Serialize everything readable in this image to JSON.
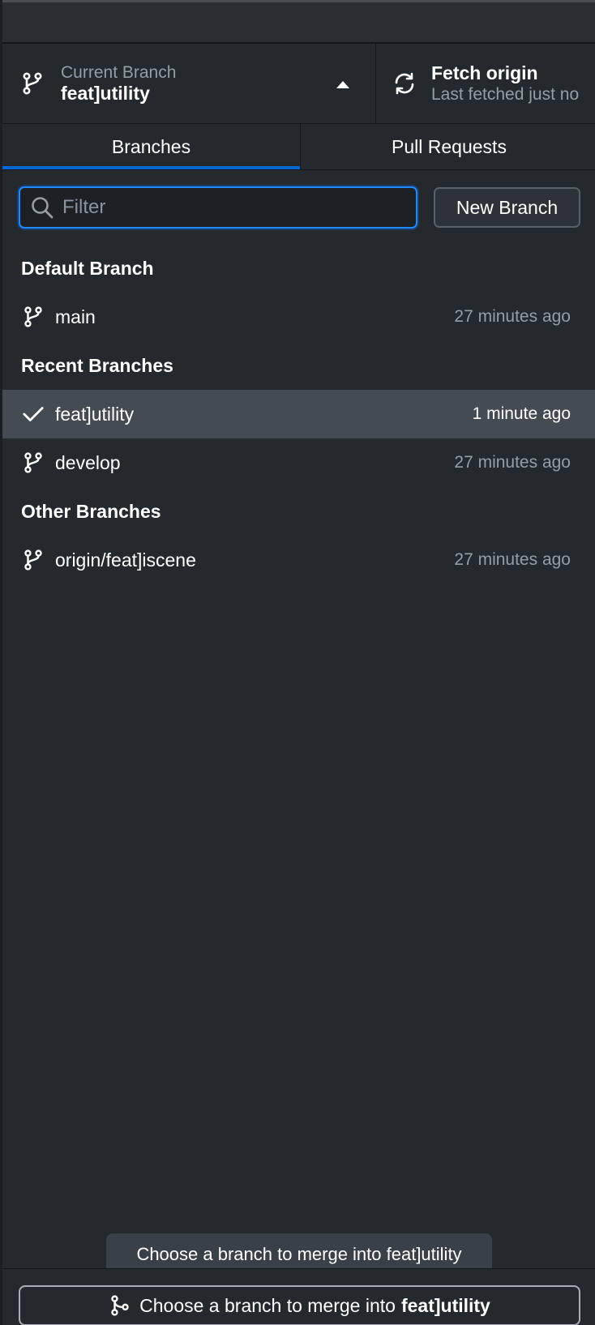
{
  "toolbar": {
    "current_branch_label": "Current Branch",
    "current_branch_value": "feat]utility",
    "fetch_title": "Fetch origin",
    "fetch_subtitle": "Last fetched just no"
  },
  "tabs": [
    {
      "label": "Branches",
      "active": true
    },
    {
      "label": "Pull Requests",
      "active": false
    }
  ],
  "filter": {
    "placeholder": "Filter",
    "value": ""
  },
  "new_branch_label": "New Branch",
  "sections": {
    "default": {
      "title": "Default Branch",
      "items": [
        {
          "name": "main",
          "time": "27 minutes ago",
          "icon": "git-branch-icon"
        }
      ]
    },
    "recent": {
      "title": "Recent Branches",
      "items": [
        {
          "name": "feat]utility",
          "time": "1 minute ago",
          "icon": "check-icon",
          "selected": true
        },
        {
          "name": "develop",
          "time": "27 minutes ago",
          "icon": "git-branch-icon"
        }
      ]
    },
    "other": {
      "title": "Other Branches",
      "items": [
        {
          "name": "origin/feat]iscene",
          "time": "27 minutes ago",
          "icon": "git-branch-icon"
        }
      ]
    }
  },
  "tooltip_text": "Choose a branch to merge into feat]utility",
  "merge_button": {
    "prefix": "Choose a branch to merge into",
    "branch": "feat]utility"
  },
  "colors": {
    "background": "#24292e",
    "accent": "#0366d6",
    "selected_row": "#444b53",
    "muted_text": "#959da5"
  }
}
